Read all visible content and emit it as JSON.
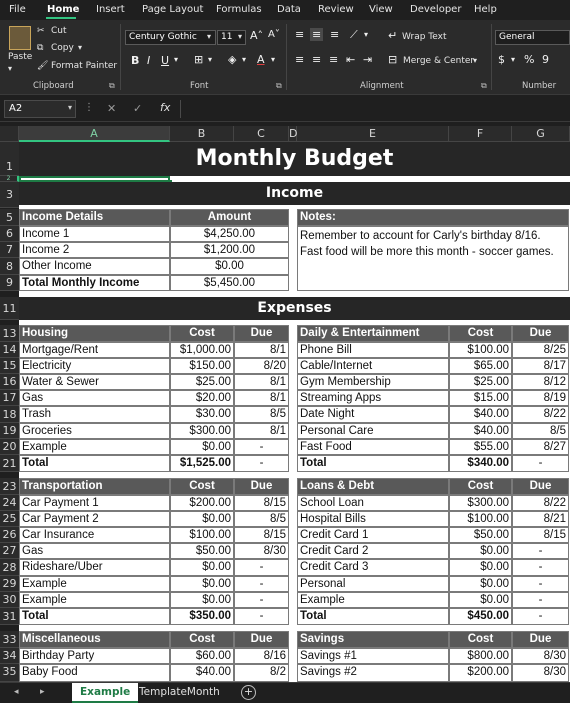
{
  "menu": [
    "File",
    "Home",
    "Insert",
    "Page Layout",
    "Formulas",
    "Data",
    "Review",
    "View",
    "Developer",
    "Help"
  ],
  "ribbon": {
    "paste": "Paste",
    "cut": "Cut",
    "copy": "Copy",
    "format_painter": "Format Painter",
    "clipboard": "Clipboard",
    "font_name": "Century Gothic",
    "font_size": "11",
    "font": "Font",
    "wrap_text": "Wrap Text",
    "merge_center": "Merge & Center",
    "alignment": "Alignment",
    "number_format": "General",
    "number": "Number",
    "bold": "B",
    "italic": "I",
    "underline": "U"
  },
  "formula_bar": {
    "name_box": "A2",
    "fx": "fx"
  },
  "columns": [
    "A",
    "B",
    "C",
    "D",
    "E",
    "F",
    "G"
  ],
  "rows": [
    "1",
    "2",
    "3",
    "5",
    "6",
    "7",
    "8",
    "9",
    "11",
    "13",
    "14",
    "15",
    "16",
    "17",
    "18",
    "19",
    "20",
    "21",
    "23",
    "24",
    "25",
    "26",
    "27",
    "28",
    "29",
    "30",
    "31",
    "33",
    "34",
    "35"
  ],
  "sheet": {
    "title": "Monthly Budget",
    "income_band": "Income",
    "income": {
      "header": [
        "Income Details",
        "Amount"
      ],
      "rows": [
        [
          "Income 1",
          "$4,250.00"
        ],
        [
          "Income 2",
          "$1,200.00"
        ],
        [
          "Other Income",
          "$0.00"
        ]
      ],
      "total": [
        "Total Monthly Income",
        "$5,450.00"
      ]
    },
    "notes": {
      "header": "Notes:",
      "lines": [
        "Remember to account for Carly's birthday 8/16.",
        "Fast food will be more this month - soccer games."
      ]
    },
    "expenses_band": "Expenses",
    "housing": {
      "header": [
        "Housing",
        "Cost",
        "Due"
      ],
      "rows": [
        [
          "Mortgage/Rent",
          "$1,000.00",
          "8/1"
        ],
        [
          "Electricity",
          "$150.00",
          "8/20"
        ],
        [
          "Water & Sewer",
          "$25.00",
          "8/1"
        ],
        [
          "Gas",
          "$20.00",
          "8/1"
        ],
        [
          "Trash",
          "$30.00",
          "8/5"
        ],
        [
          "Groceries",
          "$300.00",
          "8/1"
        ],
        [
          "Example",
          "$0.00",
          "-"
        ]
      ],
      "total": [
        "Total",
        "$1,525.00",
        "-"
      ]
    },
    "daily": {
      "header": [
        "Daily & Entertainment",
        "Cost",
        "Due"
      ],
      "rows": [
        [
          "Phone Bill",
          "$100.00",
          "8/25"
        ],
        [
          "Cable/Internet",
          "$65.00",
          "8/17"
        ],
        [
          "Gym Membership",
          "$25.00",
          "8/12"
        ],
        [
          "Streaming Apps",
          "$15.00",
          "8/19"
        ],
        [
          "Date Night",
          "$40.00",
          "8/22"
        ],
        [
          "Personal Care",
          "$40.00",
          "8/5"
        ],
        [
          "Fast Food",
          "$55.00",
          "8/27"
        ]
      ],
      "total": [
        "Total",
        "$340.00",
        "-"
      ]
    },
    "transportation": {
      "header": [
        "Transportation",
        "Cost",
        "Due"
      ],
      "rows": [
        [
          "Car Payment 1",
          "$200.00",
          "8/15"
        ],
        [
          "Car Payment 2",
          "$0.00",
          "8/5"
        ],
        [
          "Car Insurance",
          "$100.00",
          "8/15"
        ],
        [
          "Gas",
          "$50.00",
          "8/30"
        ],
        [
          "Rideshare/Uber",
          "$0.00",
          "-"
        ],
        [
          "Example",
          "$0.00",
          "-"
        ],
        [
          "Example",
          "$0.00",
          "-"
        ]
      ],
      "total": [
        "Total",
        "$350.00",
        "-"
      ]
    },
    "loans": {
      "header": [
        "Loans & Debt",
        "Cost",
        "Due"
      ],
      "rows": [
        [
          "School Loan",
          "$300.00",
          "8/22"
        ],
        [
          "Hospital Bills",
          "$100.00",
          "8/21"
        ],
        [
          "Credit Card 1",
          "$50.00",
          "8/15"
        ],
        [
          "Credit Card 2",
          "$0.00",
          "-"
        ],
        [
          "Credit Card 3",
          "$0.00",
          "-"
        ],
        [
          "Personal",
          "$0.00",
          "-"
        ],
        [
          "Example",
          "$0.00",
          "-"
        ]
      ],
      "total": [
        "Total",
        "$450.00",
        "-"
      ]
    },
    "misc": {
      "header": [
        "Miscellaneous",
        "Cost",
        "Due"
      ],
      "rows": [
        [
          "Birthday Party",
          "$60.00",
          "8/16"
        ],
        [
          "Baby Food",
          "$40.00",
          "8/2"
        ]
      ]
    },
    "savings": {
      "header": [
        "Savings",
        "Cost",
        "Due"
      ],
      "rows": [
        [
          "Savings #1",
          "$800.00",
          "8/30"
        ],
        [
          "Savings #2",
          "$200.00",
          "8/30"
        ]
      ]
    }
  },
  "tabs": [
    "Example",
    "TemplateMonth"
  ],
  "colors": {
    "accent": "#33c481",
    "header_dark": "#262626",
    "header_mid": "#595959"
  }
}
